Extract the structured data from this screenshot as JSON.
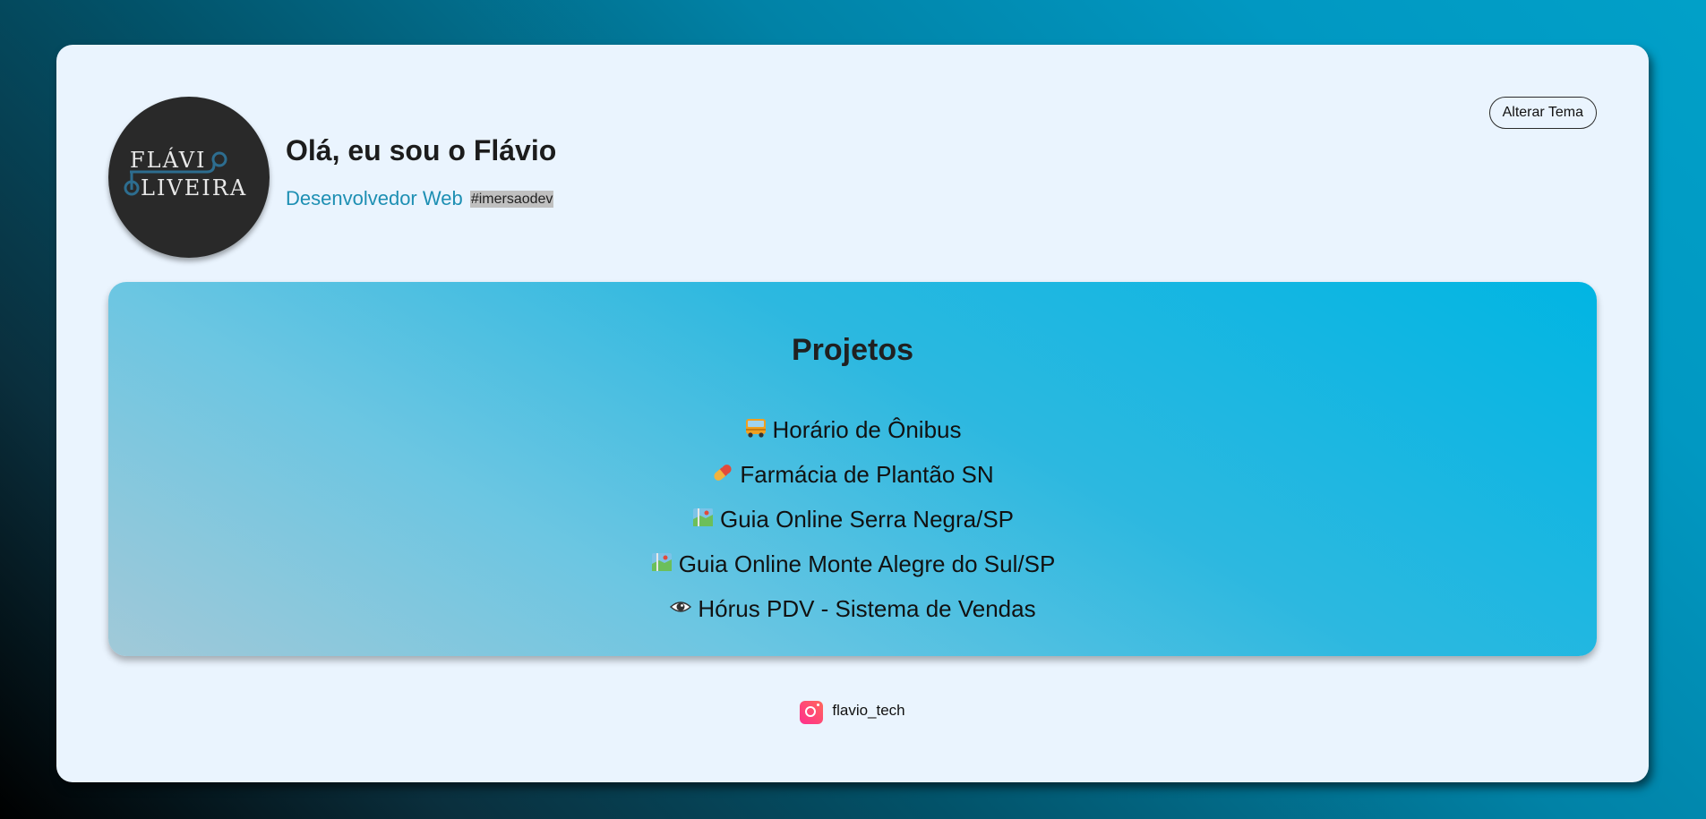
{
  "header": {
    "logo_line1": "FLÁVI",
    "logo_line2": "LIVEIRA",
    "greeting": "Olá, eu sou o Flávio",
    "role": "Desenvolvedor Web",
    "tag": "#imersaodev",
    "theme_button_label": "Alterar Tema"
  },
  "projects": {
    "title": "Projetos",
    "items": [
      {
        "icon": "bus-icon",
        "label": "Horário de Ônibus"
      },
      {
        "icon": "pill-icon",
        "label": "Farmácia de Plantão SN"
      },
      {
        "icon": "map-icon",
        "label": "Guia Online Serra Negra/SP"
      },
      {
        "icon": "map-icon",
        "label": "Guia Online Monte Alegre do Sul/SP"
      },
      {
        "icon": "eye-icon",
        "label": "Hórus PDV - Sistema de Vendas"
      }
    ]
  },
  "footer": {
    "social_icon": "instagram-icon",
    "social_handle": "flavio_tech"
  },
  "colors": {
    "card_background": "#eaf4fe",
    "accent": "#1d8fb3",
    "projects_gradient_start": "#a1c9d8",
    "projects_gradient_end": "#01b5e3",
    "avatar_background": "#292929"
  }
}
